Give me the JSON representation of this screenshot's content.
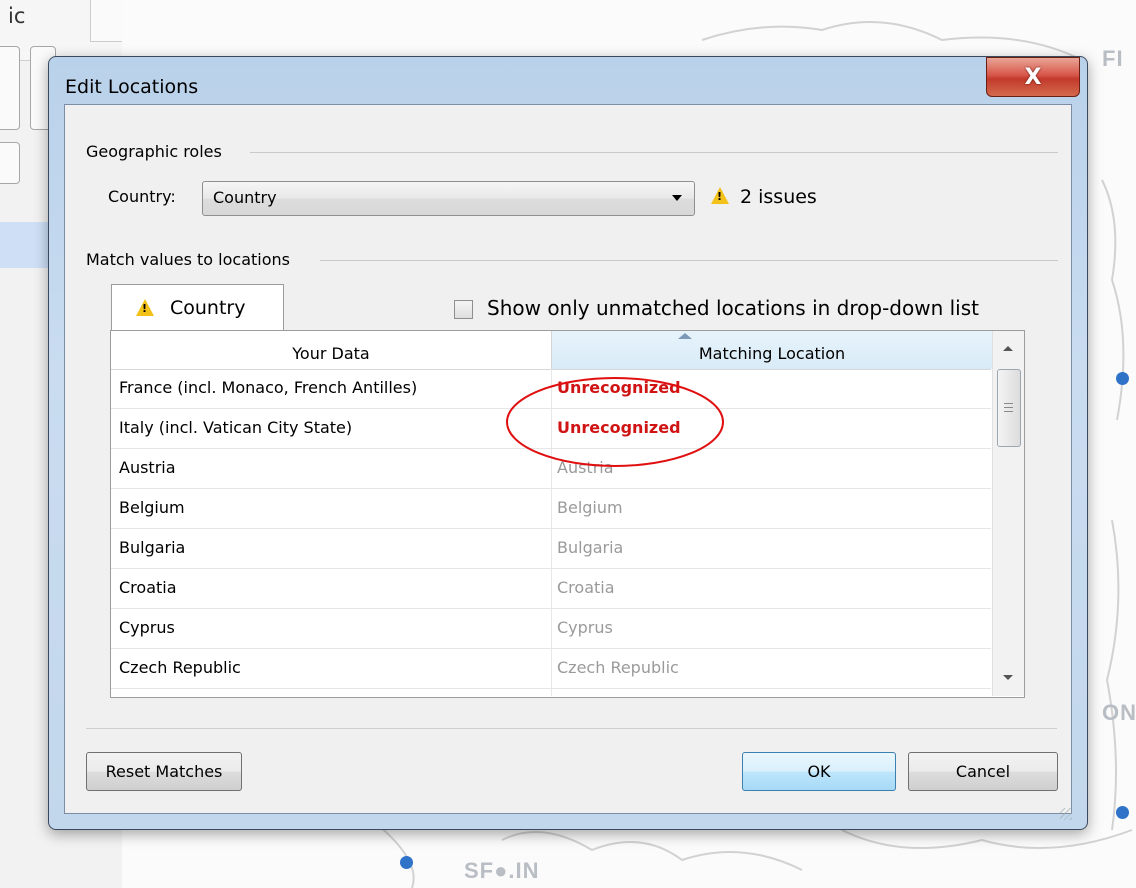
{
  "background": {
    "panel_text": "ic",
    "map_label": "SF●.IN",
    "edge_label_fi": "FI",
    "edge_label_on": "ON"
  },
  "dialog": {
    "title": "Edit Locations",
    "close_glyph": "X",
    "geographic_roles": {
      "group_label": "Geographic roles",
      "field_label": "Country:",
      "selected_value": "Country",
      "issues_text": "2 issues"
    },
    "match_values": {
      "group_label": "Match values to locations",
      "tab_label": "Country",
      "checkbox_label": "Show only unmatched locations in drop-down list",
      "checkbox_checked": false,
      "columns": [
        "Your Data",
        "Matching Location"
      ],
      "rows": [
        {
          "data": "France (incl. Monaco, French Antilles)",
          "match": "Unrecognized",
          "unrecognized": true
        },
        {
          "data": "Italy (incl. Vatican City State)",
          "match": "Unrecognized",
          "unrecognized": true
        },
        {
          "data": "Austria",
          "match": "Austria",
          "unrecognized": false
        },
        {
          "data": "Belgium",
          "match": "Belgium",
          "unrecognized": false
        },
        {
          "data": "Bulgaria",
          "match": "Bulgaria",
          "unrecognized": false
        },
        {
          "data": "Croatia",
          "match": "Croatia",
          "unrecognized": false
        },
        {
          "data": "Cyprus",
          "match": "Cyprus",
          "unrecognized": false
        },
        {
          "data": "Czech Republic",
          "match": "Czech Republic",
          "unrecognized": false
        }
      ]
    },
    "buttons": {
      "reset": "Reset Matches",
      "ok": "OK",
      "cancel": "Cancel"
    },
    "colors": {
      "unrecognized": "#d01313",
      "annotation_circle": "#e01010",
      "warning": "#f2c21b"
    }
  }
}
